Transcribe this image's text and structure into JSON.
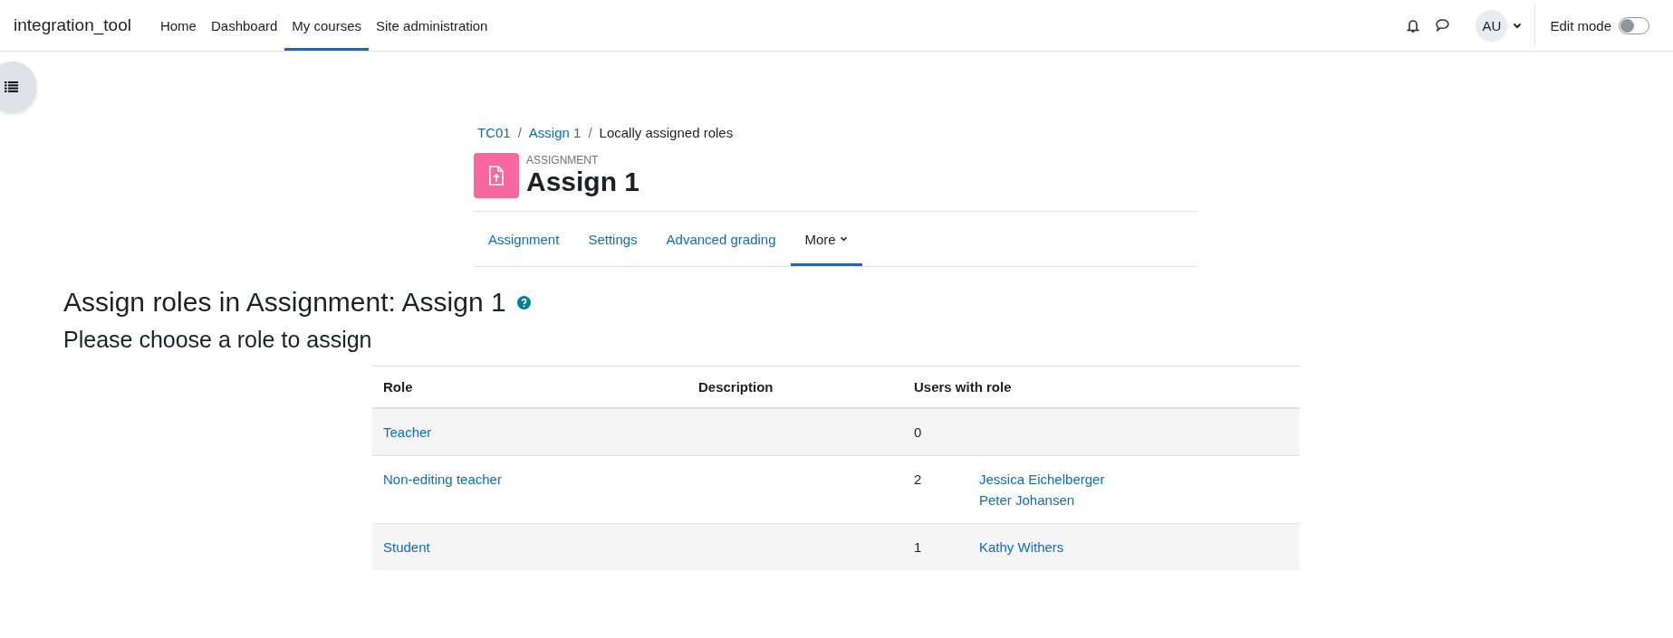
{
  "navbar": {
    "brand": "integration_tool",
    "items": [
      {
        "label": "Home",
        "selected": false
      },
      {
        "label": "Dashboard",
        "selected": false
      },
      {
        "label": "My courses",
        "selected": true
      },
      {
        "label": "Site administration",
        "selected": false
      }
    ],
    "avatar": "AU",
    "edit_mode": {
      "label": "Edit mode",
      "on": false
    }
  },
  "breadcrumb": {
    "separator": "/",
    "items": [
      {
        "label": "TC01",
        "link": true
      },
      {
        "label": "Assign 1",
        "link": true
      },
      {
        "label": "Locally assigned roles",
        "link": false
      }
    ]
  },
  "header": {
    "kind_label": "ASSIGNMENT",
    "title": "Assign 1"
  },
  "tabs": [
    {
      "label": "Assignment",
      "selected": false,
      "dropdown": false
    },
    {
      "label": "Settings",
      "selected": false,
      "dropdown": false
    },
    {
      "label": "Advanced grading",
      "selected": false,
      "dropdown": false
    },
    {
      "label": "More",
      "selected": true,
      "dropdown": true
    }
  ],
  "heading": "Assign roles in Assignment: Assign 1",
  "subheading": "Please choose a role to assign",
  "table": {
    "columns": [
      "Role",
      "Description",
      "Users with role"
    ],
    "rows": [
      {
        "role": "Teacher",
        "count": "0",
        "users": []
      },
      {
        "role": "Non-editing teacher",
        "count": "2",
        "users": [
          "Jessica Eichelberger",
          "Peter Johansen"
        ]
      },
      {
        "role": "Student",
        "count": "1",
        "users": [
          "Kathy Withers"
        ]
      }
    ]
  }
}
